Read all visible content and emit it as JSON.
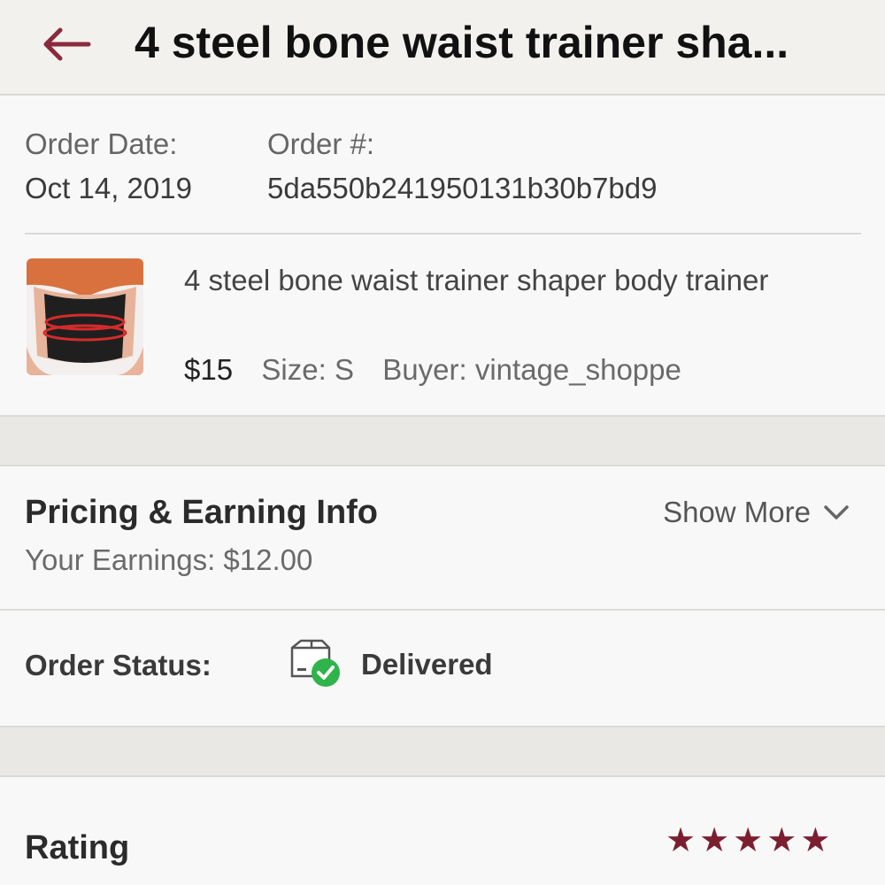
{
  "header": {
    "title": "4 steel bone waist trainer sha...",
    "back_icon": "arrow-left-icon",
    "accent_color": "#8a2a3a"
  },
  "order": {
    "date_label": "Order Date:",
    "date_value": "Oct 14, 2019",
    "number_label": "Order #:",
    "number_value": "5da550b241950131b30b7bd9"
  },
  "item": {
    "title": "4 steel bone waist trainer shaper body trainer",
    "price": "$15",
    "size": "Size: S",
    "buyer": "Buyer: vintage_shoppe"
  },
  "pricing": {
    "heading": "Pricing & Earning Info",
    "show_more": "Show More",
    "earnings": "Your Earnings: $12.00"
  },
  "status": {
    "label": "Order Status:",
    "value": "Delivered",
    "icon": "package-delivered-icon"
  },
  "rating": {
    "label": "Rating",
    "stars": 5,
    "star_color": "#7b1f2e"
  }
}
